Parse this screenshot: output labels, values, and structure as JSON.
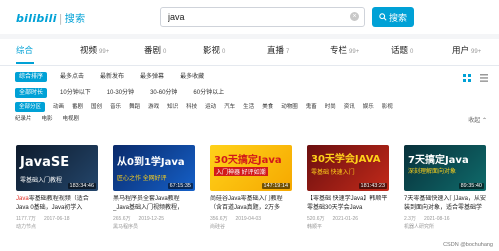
{
  "header": {
    "logo": "bilibili",
    "logo_sub": "搜索",
    "search_value": "java",
    "clear_symbol": "×",
    "search_button": "搜索"
  },
  "tabs": [
    {
      "label": "综合",
      "count": ""
    },
    {
      "label": "视频",
      "count": "99+"
    },
    {
      "label": "番剧",
      "count": "0"
    },
    {
      "label": "影视",
      "count": "0"
    },
    {
      "label": "直播",
      "count": "7"
    },
    {
      "label": "专栏",
      "count": "99+"
    },
    {
      "label": "话题",
      "count": "0"
    },
    {
      "label": "用户",
      "count": "99+"
    }
  ],
  "filters": {
    "sort": [
      "综合排序",
      "最多点击",
      "最新发布",
      "最多弹幕",
      "最多收藏"
    ],
    "duration": [
      "全部时长",
      "10分钟以下",
      "10-30分钟",
      "30-60分钟",
      "60分钟以上"
    ],
    "zone_row1": [
      "全部分区",
      "动画",
      "番剧",
      "国创",
      "音乐",
      "舞蹈",
      "游戏",
      "知识",
      "科技",
      "运动",
      "汽车",
      "生活",
      "美食",
      "动物圈",
      "鬼畜",
      "时尚",
      "资讯",
      "娱乐",
      "影视"
    ],
    "zone_row2": [
      "纪录片",
      "电影",
      "电视剧"
    ],
    "collapse": "收起 ⌃"
  },
  "videos": [
    {
      "thumb_big": "JavaSE",
      "thumb_small": "零基础入门教程",
      "duration": "183:34:46",
      "title_hl": "Java",
      "title_rest": "零基础教程视频（适合Java 0基础，Java初学入",
      "views": "1177.7万",
      "date": "2017-06-18",
      "uploader": "动力节点",
      "colors": [
        "#0d1a2b",
        "#24466b"
      ]
    },
    {
      "thumb_big": "从0到1学Java",
      "thumb_small": "匠心之作 全网好评",
      "duration": "67:15:35",
      "title_hl": "",
      "title_rest": "黑马程序员全套Java教程_Java基础入门视频教程，",
      "views": "265.6万",
      "date": "2019-12-25",
      "uploader": "黑马程序员",
      "colors": [
        "#0a2a6a",
        "#1560c8"
      ]
    },
    {
      "thumb_big": "30天搞定Java",
      "thumb_small": "入门神器  好评如潮",
      "duration": "147:19:14",
      "title_hl": "",
      "title_rest": "尚硅谷Java零基础入门教程（含百道Java真题，2万多",
      "views": "356.6万",
      "date": "2019-04-03",
      "uploader": "尚硅谷",
      "colors": [
        "#ffd21a",
        "#f6a800"
      ]
    },
    {
      "thumb_big": "30天学会JAVA",
      "thumb_small": "零基础 快速入门",
      "duration": "181:43:23",
      "title_hl": "",
      "title_rest": "【零基础 快速学Java】韩顺平 零基础30天学会Java",
      "views": "520.6万",
      "date": "2021-01-26",
      "uploader": "韩顺平",
      "colors": [
        "#6b0f0f",
        "#c22a1a"
      ]
    },
    {
      "thumb_big": "7天搞定Java",
      "thumb_small": "深刻理解面向对象",
      "duration": "89:35:40",
      "title_hl": "",
      "title_rest": "7天零基础快速入门Java，从安装到面向对象，适合零基础学习Java",
      "views": "2.3万",
      "date": "2021-08-16",
      "uploader": "机器人研究所",
      "colors": [
        "#08303a",
        "#0f6b6b"
      ]
    }
  ],
  "watermark": "CSDN @bochuhang",
  "accent": "#00a1d6",
  "highlight": "#e02e24"
}
